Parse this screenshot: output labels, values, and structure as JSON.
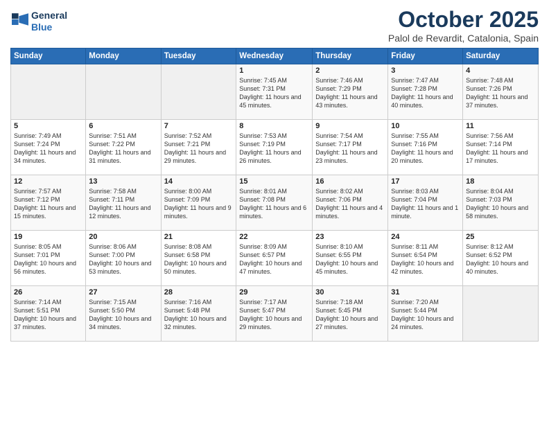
{
  "header": {
    "logo_line1": "General",
    "logo_line2": "Blue",
    "month": "October 2025",
    "location": "Palol de Revardit, Catalonia, Spain"
  },
  "weekdays": [
    "Sunday",
    "Monday",
    "Tuesday",
    "Wednesday",
    "Thursday",
    "Friday",
    "Saturday"
  ],
  "weeks": [
    [
      {
        "day": "",
        "info": ""
      },
      {
        "day": "",
        "info": ""
      },
      {
        "day": "",
        "info": ""
      },
      {
        "day": "1",
        "info": "Sunrise: 7:45 AM\nSunset: 7:31 PM\nDaylight: 11 hours and 45 minutes."
      },
      {
        "day": "2",
        "info": "Sunrise: 7:46 AM\nSunset: 7:29 PM\nDaylight: 11 hours and 43 minutes."
      },
      {
        "day": "3",
        "info": "Sunrise: 7:47 AM\nSunset: 7:28 PM\nDaylight: 11 hours and 40 minutes."
      },
      {
        "day": "4",
        "info": "Sunrise: 7:48 AM\nSunset: 7:26 PM\nDaylight: 11 hours and 37 minutes."
      }
    ],
    [
      {
        "day": "5",
        "info": "Sunrise: 7:49 AM\nSunset: 7:24 PM\nDaylight: 11 hours and 34 minutes."
      },
      {
        "day": "6",
        "info": "Sunrise: 7:51 AM\nSunset: 7:22 PM\nDaylight: 11 hours and 31 minutes."
      },
      {
        "day": "7",
        "info": "Sunrise: 7:52 AM\nSunset: 7:21 PM\nDaylight: 11 hours and 29 minutes."
      },
      {
        "day": "8",
        "info": "Sunrise: 7:53 AM\nSunset: 7:19 PM\nDaylight: 11 hours and 26 minutes."
      },
      {
        "day": "9",
        "info": "Sunrise: 7:54 AM\nSunset: 7:17 PM\nDaylight: 11 hours and 23 minutes."
      },
      {
        "day": "10",
        "info": "Sunrise: 7:55 AM\nSunset: 7:16 PM\nDaylight: 11 hours and 20 minutes."
      },
      {
        "day": "11",
        "info": "Sunrise: 7:56 AM\nSunset: 7:14 PM\nDaylight: 11 hours and 17 minutes."
      }
    ],
    [
      {
        "day": "12",
        "info": "Sunrise: 7:57 AM\nSunset: 7:12 PM\nDaylight: 11 hours and 15 minutes."
      },
      {
        "day": "13",
        "info": "Sunrise: 7:58 AM\nSunset: 7:11 PM\nDaylight: 11 hours and 12 minutes."
      },
      {
        "day": "14",
        "info": "Sunrise: 8:00 AM\nSunset: 7:09 PM\nDaylight: 11 hours and 9 minutes."
      },
      {
        "day": "15",
        "info": "Sunrise: 8:01 AM\nSunset: 7:08 PM\nDaylight: 11 hours and 6 minutes."
      },
      {
        "day": "16",
        "info": "Sunrise: 8:02 AM\nSunset: 7:06 PM\nDaylight: 11 hours and 4 minutes."
      },
      {
        "day": "17",
        "info": "Sunrise: 8:03 AM\nSunset: 7:04 PM\nDaylight: 11 hours and 1 minute."
      },
      {
        "day": "18",
        "info": "Sunrise: 8:04 AM\nSunset: 7:03 PM\nDaylight: 10 hours and 58 minutes."
      }
    ],
    [
      {
        "day": "19",
        "info": "Sunrise: 8:05 AM\nSunset: 7:01 PM\nDaylight: 10 hours and 56 minutes."
      },
      {
        "day": "20",
        "info": "Sunrise: 8:06 AM\nSunset: 7:00 PM\nDaylight: 10 hours and 53 minutes."
      },
      {
        "day": "21",
        "info": "Sunrise: 8:08 AM\nSunset: 6:58 PM\nDaylight: 10 hours and 50 minutes."
      },
      {
        "day": "22",
        "info": "Sunrise: 8:09 AM\nSunset: 6:57 PM\nDaylight: 10 hours and 47 minutes."
      },
      {
        "day": "23",
        "info": "Sunrise: 8:10 AM\nSunset: 6:55 PM\nDaylight: 10 hours and 45 minutes."
      },
      {
        "day": "24",
        "info": "Sunrise: 8:11 AM\nSunset: 6:54 PM\nDaylight: 10 hours and 42 minutes."
      },
      {
        "day": "25",
        "info": "Sunrise: 8:12 AM\nSunset: 6:52 PM\nDaylight: 10 hours and 40 minutes."
      }
    ],
    [
      {
        "day": "26",
        "info": "Sunrise: 7:14 AM\nSunset: 5:51 PM\nDaylight: 10 hours and 37 minutes."
      },
      {
        "day": "27",
        "info": "Sunrise: 7:15 AM\nSunset: 5:50 PM\nDaylight: 10 hours and 34 minutes."
      },
      {
        "day": "28",
        "info": "Sunrise: 7:16 AM\nSunset: 5:48 PM\nDaylight: 10 hours and 32 minutes."
      },
      {
        "day": "29",
        "info": "Sunrise: 7:17 AM\nSunset: 5:47 PM\nDaylight: 10 hours and 29 minutes."
      },
      {
        "day": "30",
        "info": "Sunrise: 7:18 AM\nSunset: 5:45 PM\nDaylight: 10 hours and 27 minutes."
      },
      {
        "day": "31",
        "info": "Sunrise: 7:20 AM\nSunset: 5:44 PM\nDaylight: 10 hours and 24 minutes."
      },
      {
        "day": "",
        "info": ""
      }
    ]
  ]
}
